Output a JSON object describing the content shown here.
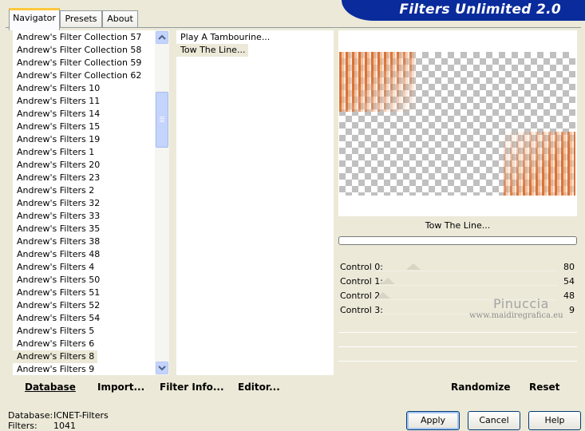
{
  "tabs": [
    {
      "label": "Navigator",
      "active": true
    },
    {
      "label": "Presets",
      "active": false
    },
    {
      "label": "About",
      "active": false
    }
  ],
  "banner": {
    "title": "Filters Unlimited 2.0"
  },
  "categories": {
    "items": [
      "Andrew's Filter Collection 57",
      "Andrew's Filter Collection 58",
      "Andrew's Filter Collection 59",
      "Andrew's Filter Collection 62",
      "Andrew's Filters 10",
      "Andrew's Filters 11",
      "Andrew's Filters 14",
      "Andrew's Filters 15",
      "Andrew's Filters 19",
      "Andrew's Filters 1",
      "Andrew's Filters 20",
      "Andrew's Filters 23",
      "Andrew's Filters 2",
      "Andrew's Filters 32",
      "Andrew's Filters 33",
      "Andrew's Filters 35",
      "Andrew's Filters 38",
      "Andrew's Filters 48",
      "Andrew's Filters 4",
      "Andrew's Filters 50",
      "Andrew's Filters 51",
      "Andrew's Filters 52",
      "Andrew's Filters 54",
      "Andrew's Filters 5",
      "Andrew's Filters 6",
      "Andrew's Filters 8",
      "Andrew's Filters 9"
    ],
    "selected": "Andrew's Filters 8"
  },
  "filters": {
    "items": [
      "Play A Tambourine...",
      "Tow The Line..."
    ],
    "selected": "Tow The Line..."
  },
  "preview": {
    "caption": "Tow The Line..."
  },
  "controls": [
    {
      "label": "Control 0:",
      "value": 80
    },
    {
      "label": "Control 1:",
      "value": 54
    },
    {
      "label": "Control 2:",
      "value": 48
    },
    {
      "label": "Control 3:",
      "value": 9
    }
  ],
  "watermark": {
    "name": "Pinuccia",
    "site": "www.maidiregrafica.eu"
  },
  "toolbar": {
    "database": "Database",
    "import": "Import...",
    "filter_info": "Filter Info...",
    "editor": "Editor...",
    "randomize": "Randomize",
    "reset": "Reset"
  },
  "status": {
    "database_label": "Database:",
    "database_value": "ICNET-Filters",
    "filters_label": "Filters:",
    "filters_value": "1041"
  },
  "buttons": {
    "apply": "Apply",
    "cancel": "Cancel",
    "help": "Help"
  }
}
